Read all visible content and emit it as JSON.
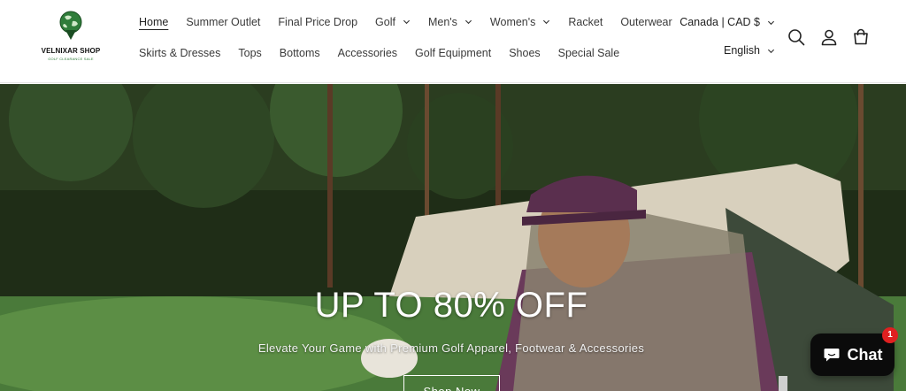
{
  "brand": {
    "name": "VELNIXAR SHOP",
    "tagline": "GOLF CLEARANCE SALE"
  },
  "nav": {
    "row1": [
      {
        "label": "Home",
        "active": true,
        "dropdown": false
      },
      {
        "label": "Summer Outlet",
        "dropdown": false
      },
      {
        "label": "Final Price Drop",
        "dropdown": false
      },
      {
        "label": "Golf",
        "dropdown": true
      },
      {
        "label": "Men's",
        "dropdown": true
      },
      {
        "label": "Women's",
        "dropdown": true
      },
      {
        "label": "Racket",
        "dropdown": false
      },
      {
        "label": "Outerwear",
        "dropdown": false
      }
    ],
    "row2": [
      {
        "label": "Skirts & Dresses"
      },
      {
        "label": "Tops"
      },
      {
        "label": "Bottoms"
      },
      {
        "label": "Accessories"
      },
      {
        "label": "Golf Equipment"
      },
      {
        "label": "Shoes"
      },
      {
        "label": "Special Sale"
      }
    ]
  },
  "locale": {
    "country": "Canada | CAD $",
    "language": "English"
  },
  "header_icons": [
    "search-icon",
    "account-icon",
    "cart-icon"
  ],
  "hero": {
    "title": "UP TO 80% OFF",
    "subtitle": "Elevate Your Game with Premium Golf Apparel, Footwear & Accessories",
    "cta": "Shop Now"
  },
  "chat": {
    "label": "Chat",
    "badge": "1"
  },
  "colors": {
    "accent": "#2f7d3a",
    "chat_bg": "#0b0b0b",
    "badge": "#e02020"
  }
}
